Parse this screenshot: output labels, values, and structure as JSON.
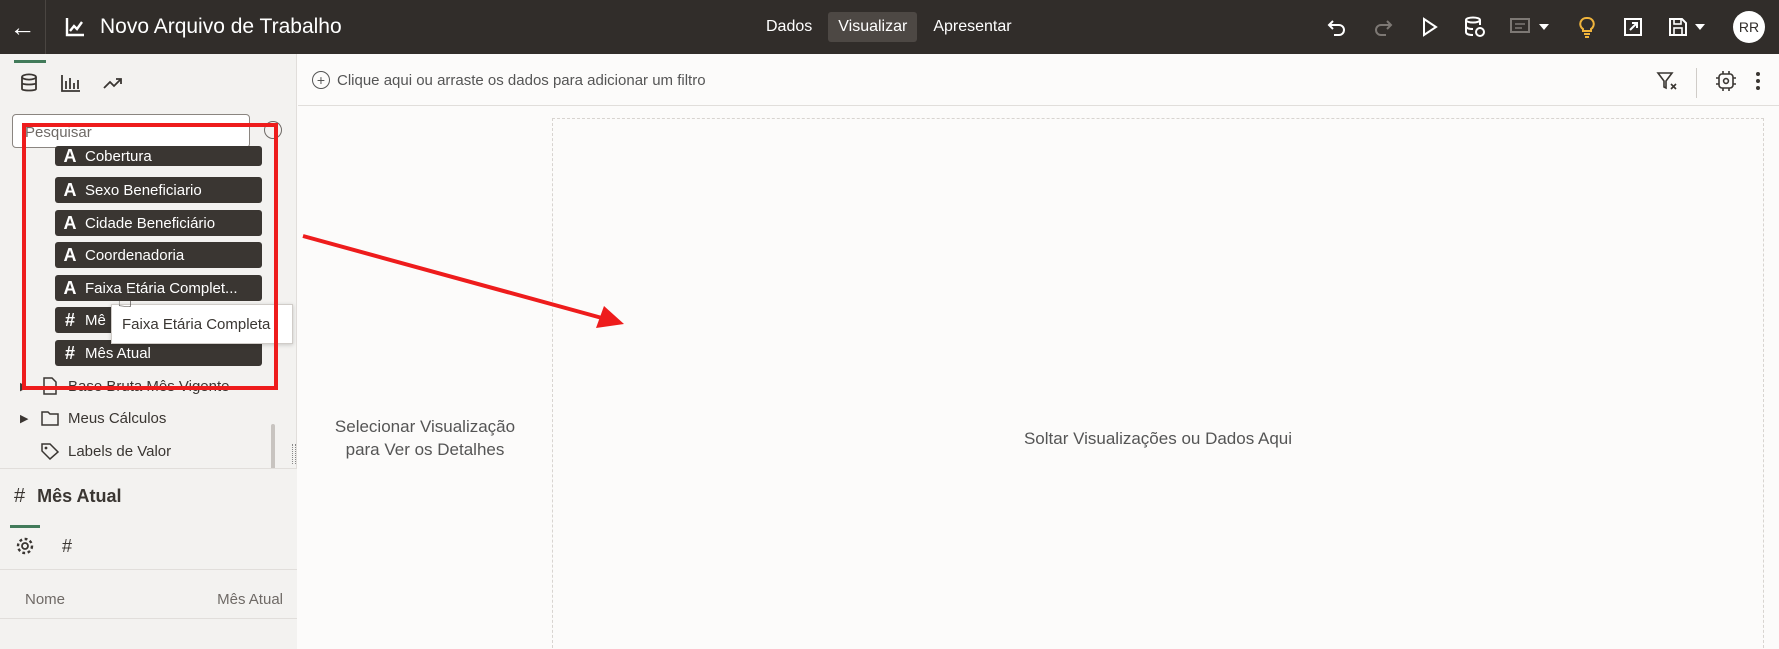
{
  "header": {
    "title": "Novo Arquivo de Trabalho",
    "tabs": [
      {
        "label": "Dados",
        "active": false
      },
      {
        "label": "Visualizar",
        "active": true
      },
      {
        "label": "Apresentar",
        "active": false
      }
    ],
    "toolbar_icons": [
      "undo-icon",
      "redo-icon",
      "play-icon",
      "refresh-data-icon",
      "comments-icon",
      "insights-icon",
      "export-icon",
      "save-icon"
    ],
    "avatar_initials": "RR",
    "colors": {
      "bar": "#312d2a",
      "accent": "#427b5a",
      "insights": "#f0b43c",
      "annotation": "#ee1c1c"
    }
  },
  "sidebar": {
    "tabs": [
      "data-icon",
      "visualizations-icon",
      "analytics-icon"
    ],
    "search": {
      "placeholder": "Pesquisar"
    },
    "fields": [
      {
        "type": "A",
        "label": "Cobertura"
      },
      {
        "type": "A",
        "label": "Sexo Beneficiario"
      },
      {
        "type": "A",
        "label": "Cidade Beneficiário"
      },
      {
        "type": "A",
        "label": "Coordenadoria"
      },
      {
        "type": "A",
        "label": "Faixa Etária Complet..."
      },
      {
        "type": "#",
        "label": "Mê"
      },
      {
        "type": "#",
        "label": "Mês Atual"
      }
    ],
    "tree": [
      {
        "label": "Base Bruta Mês Vigente",
        "icon": "file-icon"
      },
      {
        "label": "Meus Cálculos",
        "icon": "folder-icon"
      },
      {
        "label": "Labels de Valor",
        "icon": "tag-icon"
      }
    ],
    "tooltip": "Faixa Etária Completa"
  },
  "properties": {
    "title_type": "#",
    "title": "Mês Atual",
    "tabs": [
      "settings-icon",
      "number-format-icon"
    ],
    "number_tab_glyph": "#",
    "row": {
      "label": "Nome",
      "value": "Mês Atual"
    }
  },
  "filter_bar": {
    "add_label": "Clique aqui ou arraste os dados para adicionar um filtro"
  },
  "main": {
    "details_text_1": "Selecionar Visualização",
    "details_text_2": "para Ver os Detalhes",
    "drop_text": "Soltar Visualizações ou Dados Aqui"
  }
}
